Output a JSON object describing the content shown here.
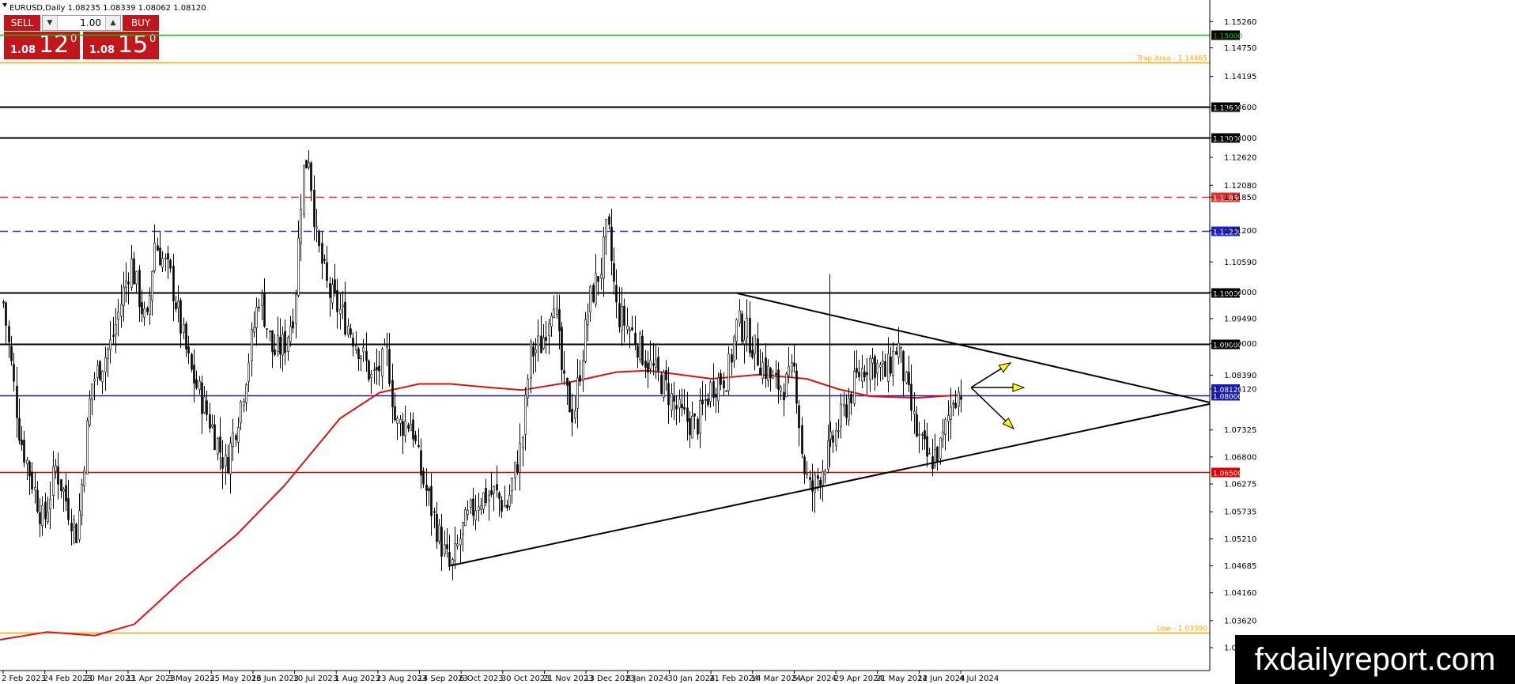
{
  "header": {
    "text": "EURUSD,Daily  1.08235 1.08339 1.08062 1.08120"
  },
  "trade_panel": {
    "sell_label": "SELL",
    "buy_label": "BUY",
    "lot": "1.00",
    "sell_small": "1.08",
    "sell_big": "12",
    "sell_sup": "0",
    "buy_small": "1.08",
    "buy_big": "15",
    "buy_sup": "0"
  },
  "brand": "fxdailyreport.com",
  "chart_data": {
    "type": "candlestick",
    "symbol": "EURUSD",
    "timeframe": "Daily",
    "ohlc": {
      "open": 1.08235,
      "high": 1.08339,
      "low": 1.08062,
      "close": 1.0812
    },
    "ylim": [
      1.0265,
      1.1568
    ],
    "y_ticks": [
      "1.15260",
      "1.14750",
      "1.14195",
      "1.13600",
      "1.13000",
      "1.12620",
      "1.12080",
      "1.11850",
      "1.11200",
      "1.10590",
      "1.10000",
      "1.09490",
      "1.09000",
      "1.08390",
      "1.08120",
      "1.07325",
      "1.06800",
      "1.06275",
      "1.05735",
      "1.05210",
      "1.04685",
      "1.04160",
      "1.03620",
      "1.03095"
    ],
    "x_ticks": [
      "2 Feb 2023",
      "24 Feb 2023",
      "20 Mar 2023",
      "11 Apr 2023",
      "3 May 2023",
      "25 May 2023",
      "16 Jun 2023",
      "10 Jul 2023",
      "1 Aug 2023",
      "23 Aug 2023",
      "14 Sep 2023",
      "6 Oct 2023",
      "30 Oct 2023",
      "21 Nov 2023",
      "13 Dec 2023",
      "8 Jan 2024",
      "30 Jan 2024",
      "21 Feb 2024",
      "14 Mar 2024",
      "5 Apr 2024",
      "29 Apr 2024",
      "21 May 2024",
      "12 Jun 2024",
      "4 Jul 2024"
    ],
    "levels": [
      {
        "value": 1.15,
        "label": "1.15000",
        "color": "#00c800",
        "style": "solid"
      },
      {
        "value": 1.14465,
        "label": "Trap Area - 1.14465",
        "color": "#ffa500",
        "style": "solid"
      },
      {
        "value": 1.136,
        "label": "1.13600",
        "color": "#000000",
        "style": "solid"
      },
      {
        "value": 1.13,
        "label": "1.13000",
        "color": "#000000",
        "style": "solid"
      },
      {
        "value": 1.1185,
        "label": "1.11850",
        "color": "#e03030",
        "style": "dashed"
      },
      {
        "value": 1.112,
        "label": "1.11200",
        "color": "#2020c0",
        "style": "dashed"
      },
      {
        "value": 1.1,
        "label": "1.10000",
        "color": "#000000",
        "style": "solid"
      },
      {
        "value": 1.09,
        "label": "1.09000",
        "color": "#000000",
        "style": "solid"
      },
      {
        "value": 1.08,
        "label": "1.08000",
        "color": "#1a1aa8",
        "style": "solid"
      },
      {
        "value": 1.065,
        "label": "1.06500",
        "color": "#e00000",
        "style": "solid"
      },
      {
        "value": 1.0339,
        "label": "Low - 1.03390",
        "color": "#ffa500",
        "style": "solid"
      }
    ],
    "current_price_label": "1.08120",
    "moving_average": {
      "color": "#dd1111",
      "points": [
        [
          0,
          1.0325
        ],
        [
          60,
          1.034
        ],
        [
          120,
          1.0333
        ],
        [
          170,
          1.0355
        ],
        [
          230,
          1.044
        ],
        [
          300,
          1.053
        ],
        [
          360,
          1.0625
        ],
        [
          430,
          1.0755
        ],
        [
          480,
          1.0805
        ],
        [
          530,
          1.0822
        ],
        [
          570,
          1.0822
        ],
        [
          620,
          1.0815
        ],
        [
          660,
          1.081
        ],
        [
          720,
          1.0825
        ],
        [
          780,
          1.0845
        ],
        [
          820,
          1.0848
        ],
        [
          860,
          1.084
        ],
        [
          900,
          1.0832
        ],
        [
          960,
          1.084
        ],
        [
          1020,
          1.0832
        ],
        [
          1060,
          1.0812
        ],
        [
          1100,
          1.0798
        ],
        [
          1160,
          1.0795
        ],
        [
          1210,
          1.08
        ]
      ]
    },
    "trendlines": [
      {
        "from": [
          567,
          1.0468
        ],
        "to": [
          1530,
          1.0783
        ]
      },
      {
        "from": [
          932,
          1.0998
        ],
        "to": [
          1530,
          1.0786
        ]
      }
    ],
    "arrows": [
      {
        "direction": "up",
        "to": [
          1278,
          1.0863
        ]
      },
      {
        "direction": "flat",
        "to": [
          1295,
          1.0815
        ]
      },
      {
        "direction": "down",
        "to": [
          1282,
          1.0735
        ]
      }
    ],
    "price_path": [
      [
        4,
        1.098
      ],
      [
        25,
        1.072
      ],
      [
        55,
        1.055
      ],
      [
        70,
        1.066
      ],
      [
        97,
        1.053
      ],
      [
        115,
        1.082
      ],
      [
        140,
        1.09
      ],
      [
        165,
        1.106
      ],
      [
        185,
        1.093
      ],
      [
        195,
        1.11
      ],
      [
        215,
        1.103
      ],
      [
        240,
        1.085
      ],
      [
        270,
        1.073
      ],
      [
        285,
        1.066
      ],
      [
        305,
        1.079
      ],
      [
        328,
        1.1
      ],
      [
        345,
        1.088
      ],
      [
        360,
        1.09
      ],
      [
        372,
        1.097
      ],
      [
        382,
        1.123
      ],
      [
        390,
        1.127
      ],
      [
        400,
        1.11
      ],
      [
        415,
        1.1
      ],
      [
        435,
        1.095
      ],
      [
        455,
        1.089
      ],
      [
        470,
        1.083
      ],
      [
        490,
        1.088
      ],
      [
        500,
        1.074
      ],
      [
        520,
        1.075
      ],
      [
        530,
        1.066
      ],
      [
        545,
        1.058
      ],
      [
        560,
        1.05
      ],
      [
        570,
        1.046
      ],
      [
        585,
        1.054
      ],
      [
        605,
        1.06
      ],
      [
        625,
        1.061
      ],
      [
        640,
        1.058
      ],
      [
        660,
        1.071
      ],
      [
        670,
        1.088
      ],
      [
        685,
        1.09
      ],
      [
        700,
        1.1
      ],
      [
        712,
        1.082
      ],
      [
        725,
        1.076
      ],
      [
        745,
        1.098
      ],
      [
        760,
        1.105
      ],
      [
        768,
        1.113
      ],
      [
        780,
        1.096
      ],
      [
        800,
        1.092
      ],
      [
        820,
        1.086
      ],
      [
        840,
        1.082
      ],
      [
        860,
        1.076
      ],
      [
        880,
        1.074
      ],
      [
        900,
        1.082
      ],
      [
        920,
        1.084
      ],
      [
        932,
        1.094
      ],
      [
        945,
        1.092
      ],
      [
        960,
        1.087
      ],
      [
        980,
        1.082
      ],
      [
        995,
        1.082
      ],
      [
        1005,
        1.085
      ],
      [
        1015,
        1.067
      ],
      [
        1025,
        1.061
      ],
      [
        1040,
        1.066
      ],
      [
        1055,
        1.072
      ],
      [
        1070,
        1.078
      ],
      [
        1085,
        1.084
      ],
      [
        1100,
        1.087
      ],
      [
        1120,
        1.084
      ],
      [
        1135,
        1.09
      ],
      [
        1148,
        1.08
      ],
      [
        1160,
        1.072
      ],
      [
        1175,
        1.067
      ],
      [
        1190,
        1.07
      ],
      [
        1205,
        1.08
      ],
      [
        1218,
        1.0812
      ]
    ]
  }
}
